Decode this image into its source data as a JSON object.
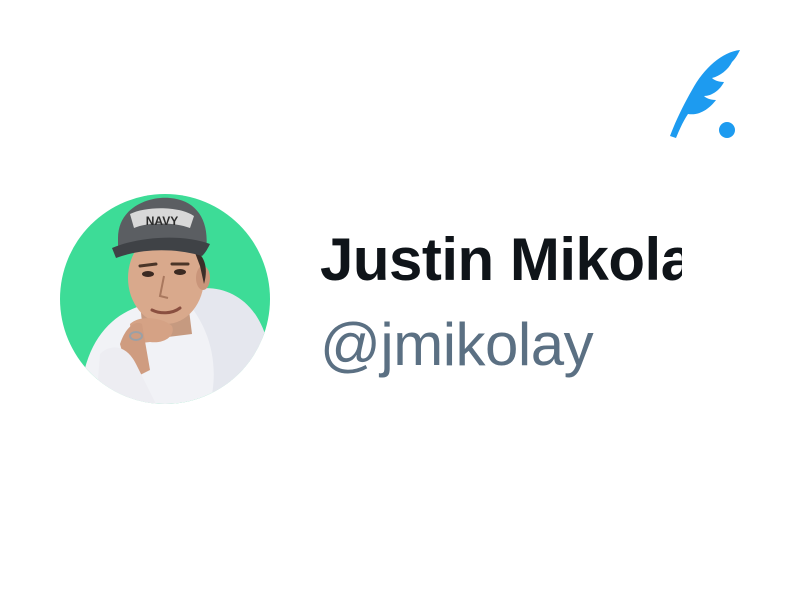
{
  "profile": {
    "display_name": "Justin Mikolay",
    "handle": "@jmikolay",
    "avatar_label": "Profile photo",
    "cap_text": "NAVY"
  },
  "brand": {
    "logo_icon": "feather-quill-icon"
  },
  "colors": {
    "accent": "#1d9bf0",
    "avatar_background": "#3ddc97",
    "name_text": "#0f1419",
    "handle_text": "#5b7083"
  }
}
